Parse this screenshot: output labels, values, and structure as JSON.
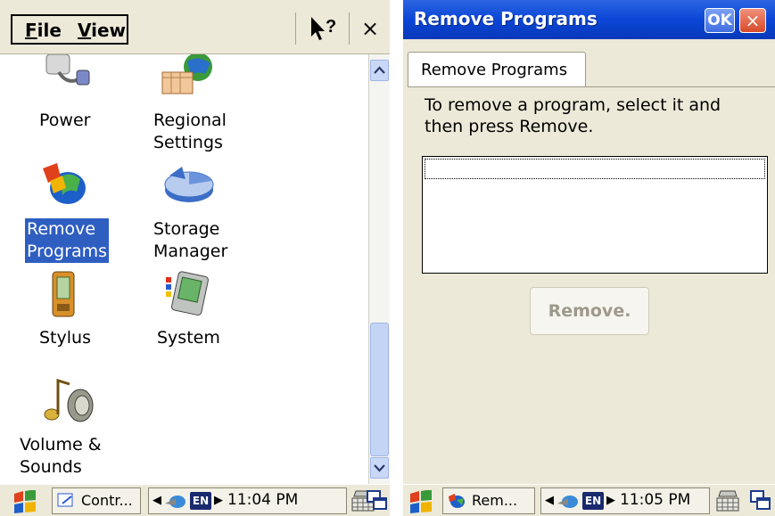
{
  "left": {
    "menu": {
      "file": "File",
      "file_rest": "ile",
      "view": "View",
      "view_rest": "iew"
    },
    "help_icon": "help-pointer-icon",
    "close": "×",
    "items": [
      {
        "label": "Power",
        "icon": "power-plug-icon"
      },
      {
        "label": "Regional Settings",
        "line1": "Regional",
        "line2": "Settings",
        "icon": "globe-calendar-icon"
      },
      {
        "label": "Remove Programs",
        "line1": "Remove",
        "line2": "Programs",
        "icon": "remove-programs-icon",
        "selected": true
      },
      {
        "label": "Storage Manager",
        "line1": "Storage",
        "line2": "Manager",
        "icon": "pie-storage-icon"
      },
      {
        "label": "Stylus",
        "icon": "pda-stylus-icon"
      },
      {
        "label": "System",
        "icon": "system-pda-icon"
      },
      {
        "label": "Volume & Sounds",
        "line1": "Volume &",
        "line2": "Sounds",
        "icon": "speaker-note-icon"
      }
    ],
    "taskbar": {
      "task_label": "Contr...",
      "lang": "EN",
      "time": "11:04 PM"
    }
  },
  "right": {
    "title": "Remove Programs",
    "ok": "OK",
    "close": "×",
    "tab_label": "Remove Programs",
    "instructions": "To remove a program, select it and then press Remove.",
    "remove_button": "Remove.",
    "taskbar": {
      "task_label": "Rem...",
      "lang": "EN",
      "time": "11:05 PM"
    }
  },
  "colors": {
    "selection": "#2f5ec1",
    "titlebar": "#0a46d8",
    "dialog_bg": "#ece9d8"
  }
}
